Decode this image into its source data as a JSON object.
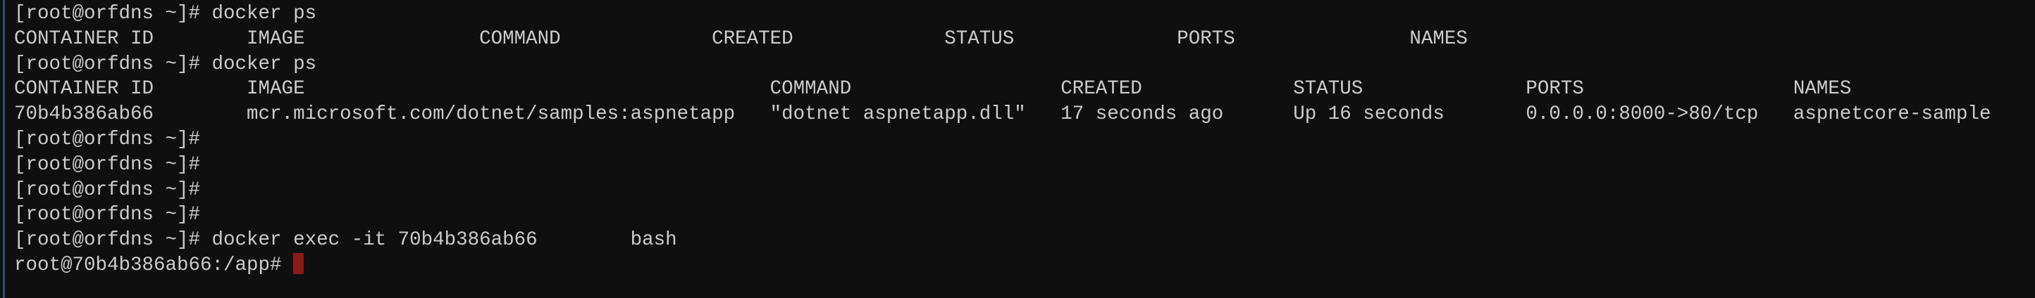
{
  "terminal": {
    "lines": [
      "[root@orfdns ~]# docker ps",
      "CONTAINER ID        IMAGE               COMMAND             CREATED             STATUS              PORTS               NAMES",
      "[root@orfdns ~]# docker ps",
      "CONTAINER ID        IMAGE                                        COMMAND                  CREATED             STATUS              PORTS                  NAMES",
      "70b4b386ab66        mcr.microsoft.com/dotnet/samples:aspnetapp   \"dotnet aspnetapp.dll\"   17 seconds ago      Up 16 seconds       0.0.0.0:8000->80/tcp   aspnetcore-sample",
      "[root@orfdns ~]#",
      "[root@orfdns ~]#",
      "[root@orfdns ~]#",
      "[root@orfdns ~]#",
      "[root@orfdns ~]# docker exec -it 70b4b386ab66        bash"
    ],
    "prompt": "root@70b4b386ab66:/app# ",
    "cursor_color": "#8b1a1a",
    "background_color": "#0f0f0f",
    "text_color": "#cccccc"
  }
}
